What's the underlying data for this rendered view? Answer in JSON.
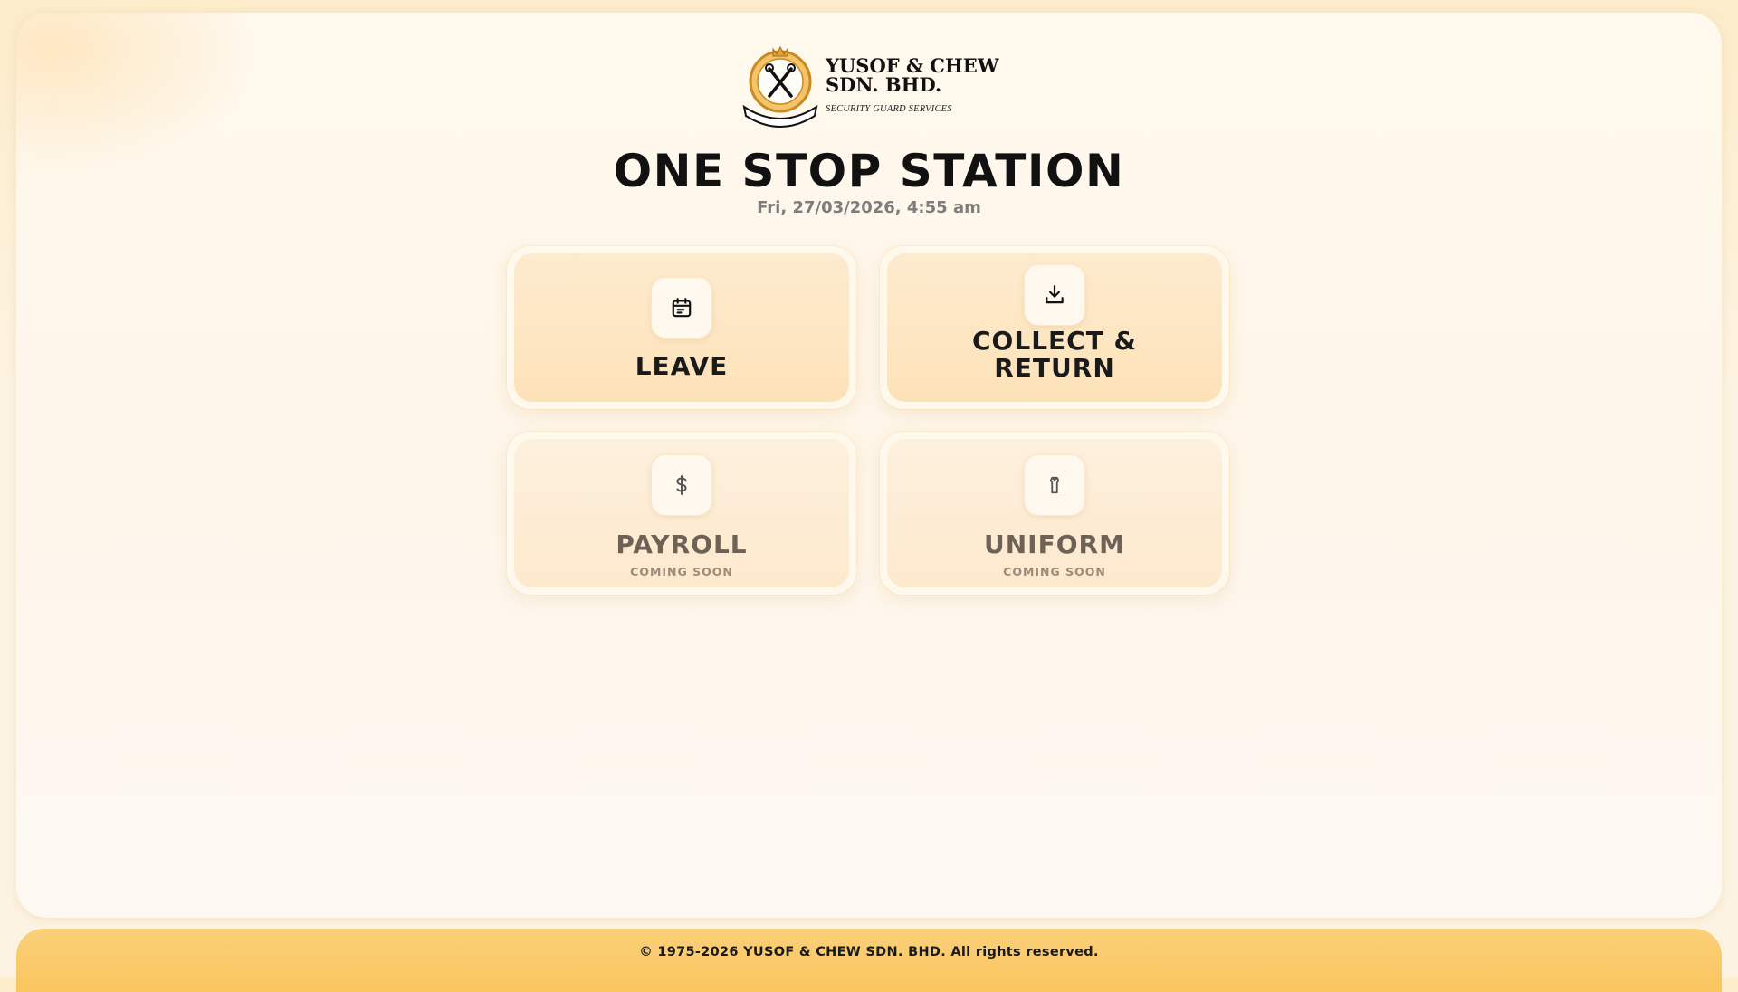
{
  "brand": {
    "name_line1": "YUSOF & CHEW",
    "name_line2": "SDN. BHD.",
    "tagline": "SECURITY GUARD SERVICES"
  },
  "header": {
    "title": "ONE STOP STATION",
    "datetime": "Fri, 27/03/2026, 4:55 am"
  },
  "tiles": [
    {
      "label": "LEAVE",
      "icon": "calendar-icon",
      "status": ""
    },
    {
      "label_line1": "COLLECT &",
      "label_line2": "RETURN",
      "icon": "download-tray-icon",
      "status": ""
    },
    {
      "label": "PAYROLL",
      "icon": "dollar-icon",
      "status": "COMING SOON"
    },
    {
      "label": "UNIFORM",
      "icon": "shirt-icon",
      "status": "COMING SOON"
    }
  ],
  "footer": {
    "copyright": "© 1975-2026 YUSOF & CHEW SDN. BHD. All rights reserved."
  },
  "colors": {
    "accent": "#f9c55e",
    "tile": "#fde2b8",
    "text": "#111111"
  }
}
